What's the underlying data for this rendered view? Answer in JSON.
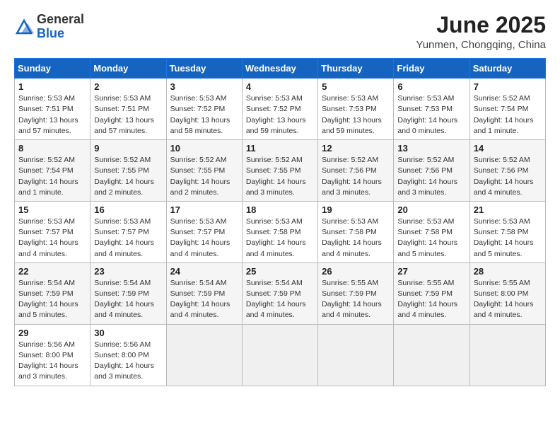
{
  "header": {
    "logo_general": "General",
    "logo_blue": "Blue",
    "title": "June 2025",
    "subtitle": "Yunmen, Chongqing, China"
  },
  "weekdays": [
    "Sunday",
    "Monday",
    "Tuesday",
    "Wednesday",
    "Thursday",
    "Friday",
    "Saturday"
  ],
  "weeks": [
    [
      {
        "day": "1",
        "info": "Sunrise: 5:53 AM\nSunset: 7:51 PM\nDaylight: 13 hours\nand 57 minutes."
      },
      {
        "day": "2",
        "info": "Sunrise: 5:53 AM\nSunset: 7:51 PM\nDaylight: 13 hours\nand 57 minutes."
      },
      {
        "day": "3",
        "info": "Sunrise: 5:53 AM\nSunset: 7:52 PM\nDaylight: 13 hours\nand 58 minutes."
      },
      {
        "day": "4",
        "info": "Sunrise: 5:53 AM\nSunset: 7:52 PM\nDaylight: 13 hours\nand 59 minutes."
      },
      {
        "day": "5",
        "info": "Sunrise: 5:53 AM\nSunset: 7:53 PM\nDaylight: 13 hours\nand 59 minutes."
      },
      {
        "day": "6",
        "info": "Sunrise: 5:53 AM\nSunset: 7:53 PM\nDaylight: 14 hours\nand 0 minutes."
      },
      {
        "day": "7",
        "info": "Sunrise: 5:52 AM\nSunset: 7:54 PM\nDaylight: 14 hours\nand 1 minute."
      }
    ],
    [
      {
        "day": "8",
        "info": "Sunrise: 5:52 AM\nSunset: 7:54 PM\nDaylight: 14 hours\nand 1 minute."
      },
      {
        "day": "9",
        "info": "Sunrise: 5:52 AM\nSunset: 7:55 PM\nDaylight: 14 hours\nand 2 minutes."
      },
      {
        "day": "10",
        "info": "Sunrise: 5:52 AM\nSunset: 7:55 PM\nDaylight: 14 hours\nand 2 minutes."
      },
      {
        "day": "11",
        "info": "Sunrise: 5:52 AM\nSunset: 7:55 PM\nDaylight: 14 hours\nand 3 minutes."
      },
      {
        "day": "12",
        "info": "Sunrise: 5:52 AM\nSunset: 7:56 PM\nDaylight: 14 hours\nand 3 minutes."
      },
      {
        "day": "13",
        "info": "Sunrise: 5:52 AM\nSunset: 7:56 PM\nDaylight: 14 hours\nand 3 minutes."
      },
      {
        "day": "14",
        "info": "Sunrise: 5:52 AM\nSunset: 7:56 PM\nDaylight: 14 hours\nand 4 minutes."
      }
    ],
    [
      {
        "day": "15",
        "info": "Sunrise: 5:53 AM\nSunset: 7:57 PM\nDaylight: 14 hours\nand 4 minutes."
      },
      {
        "day": "16",
        "info": "Sunrise: 5:53 AM\nSunset: 7:57 PM\nDaylight: 14 hours\nand 4 minutes."
      },
      {
        "day": "17",
        "info": "Sunrise: 5:53 AM\nSunset: 7:57 PM\nDaylight: 14 hours\nand 4 minutes."
      },
      {
        "day": "18",
        "info": "Sunrise: 5:53 AM\nSunset: 7:58 PM\nDaylight: 14 hours\nand 4 minutes."
      },
      {
        "day": "19",
        "info": "Sunrise: 5:53 AM\nSunset: 7:58 PM\nDaylight: 14 hours\nand 4 minutes."
      },
      {
        "day": "20",
        "info": "Sunrise: 5:53 AM\nSunset: 7:58 PM\nDaylight: 14 hours\nand 5 minutes."
      },
      {
        "day": "21",
        "info": "Sunrise: 5:53 AM\nSunset: 7:58 PM\nDaylight: 14 hours\nand 5 minutes."
      }
    ],
    [
      {
        "day": "22",
        "info": "Sunrise: 5:54 AM\nSunset: 7:59 PM\nDaylight: 14 hours\nand 5 minutes."
      },
      {
        "day": "23",
        "info": "Sunrise: 5:54 AM\nSunset: 7:59 PM\nDaylight: 14 hours\nand 4 minutes."
      },
      {
        "day": "24",
        "info": "Sunrise: 5:54 AM\nSunset: 7:59 PM\nDaylight: 14 hours\nand 4 minutes."
      },
      {
        "day": "25",
        "info": "Sunrise: 5:54 AM\nSunset: 7:59 PM\nDaylight: 14 hours\nand 4 minutes."
      },
      {
        "day": "26",
        "info": "Sunrise: 5:55 AM\nSunset: 7:59 PM\nDaylight: 14 hours\nand 4 minutes."
      },
      {
        "day": "27",
        "info": "Sunrise: 5:55 AM\nSunset: 7:59 PM\nDaylight: 14 hours\nand 4 minutes."
      },
      {
        "day": "28",
        "info": "Sunrise: 5:55 AM\nSunset: 8:00 PM\nDaylight: 14 hours\nand 4 minutes."
      }
    ],
    [
      {
        "day": "29",
        "info": "Sunrise: 5:56 AM\nSunset: 8:00 PM\nDaylight: 14 hours\nand 3 minutes."
      },
      {
        "day": "30",
        "info": "Sunrise: 5:56 AM\nSunset: 8:00 PM\nDaylight: 14 hours\nand 3 minutes."
      },
      {
        "day": "",
        "info": ""
      },
      {
        "day": "",
        "info": ""
      },
      {
        "day": "",
        "info": ""
      },
      {
        "day": "",
        "info": ""
      },
      {
        "day": "",
        "info": ""
      }
    ]
  ]
}
